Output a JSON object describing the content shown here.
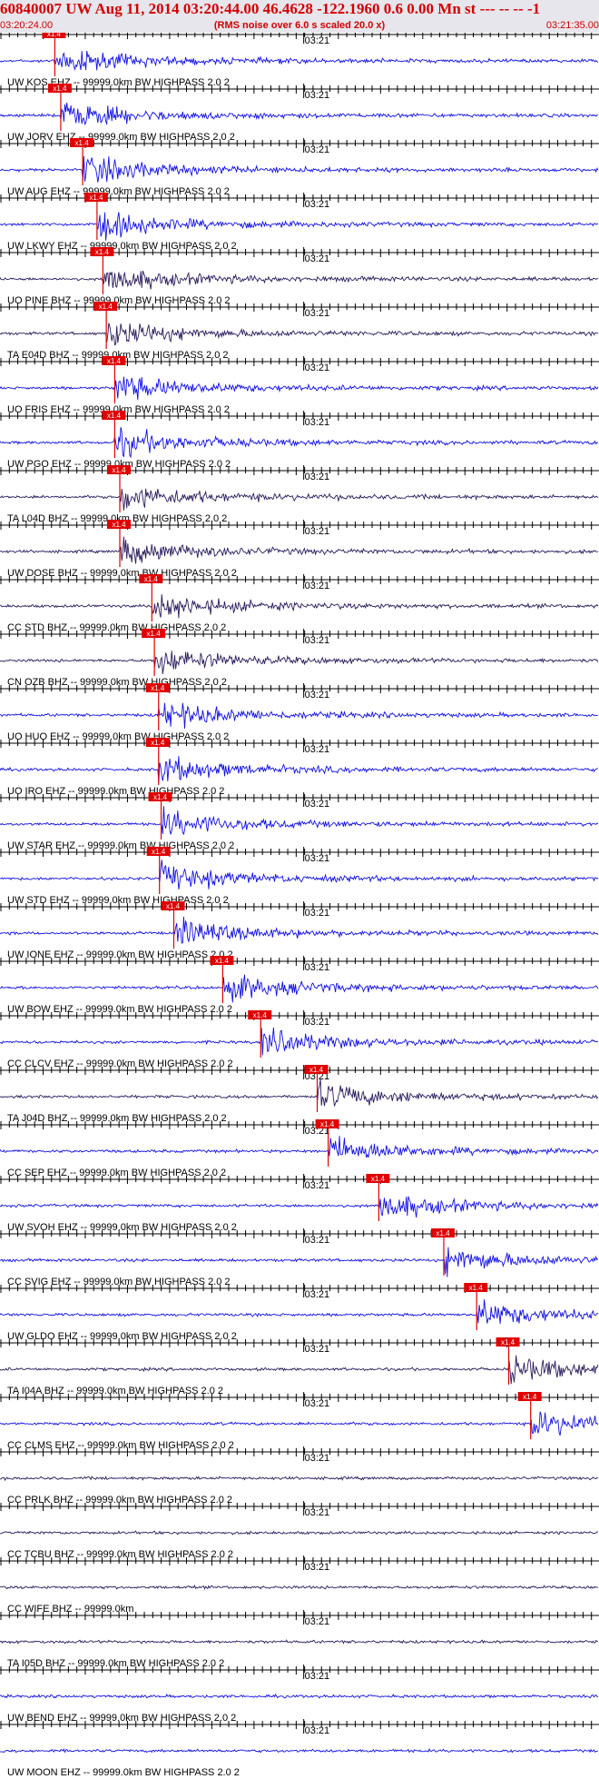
{
  "header": {
    "title": "60840007 UW Aug 11, 2014 03:20:44.00   46.4628 -122.1960  0.6 0.00 Mn st --- -- --   -1",
    "subtitle": "(RMS noise over 6.0 s scaled 20.0 x)",
    "start_time": "03:20:24.00",
    "end_time": "03:21:35.00"
  },
  "colors": {
    "wave_blue": "#1010e8",
    "wave_dark": "#2a1a5e",
    "pick": "#e00000",
    "marker_bg": "#e00000"
  },
  "chart_data": {
    "type": "seismogram",
    "time_tick_label": "03:21",
    "pick_label": "x1.4",
    "x_range_seconds": [
      0,
      71
    ],
    "traces": [
      {
        "label": "UW KOS EHZ -- 99999.0km BW  HIGHPASS  2.0  2",
        "color": "blue",
        "pick_s": 6.5
      },
      {
        "label": "UW JORV EHZ -- 99999.0km BW  HIGHPASS  2.0  2",
        "color": "blue",
        "pick_s": 7.2
      },
      {
        "label": "UW AUG EHZ -- 99999.0km BW  HIGHPASS  2.0  2",
        "color": "blue",
        "pick_s": 9.8
      },
      {
        "label": "UW LKWY EHZ -- 99999.0km BW  HIGHPASS  2.0  2",
        "color": "blue",
        "pick_s": 11.5
      },
      {
        "label": "UO PINE BHZ -- 99999.0km BW  HIGHPASS  2.0  2",
        "color": "dark",
        "pick_s": 12.2
      },
      {
        "label": "TA E04D BHZ -- 99999.0km BW  HIGHPASS  2.0  2",
        "color": "dark",
        "pick_s": 12.6
      },
      {
        "label": "UO FRIS EHZ -- 99999.0km BW  HIGHPASS  2.0  2",
        "color": "blue",
        "pick_s": 13.6
      },
      {
        "label": "UW PGO EHZ -- 99999.0km BW  HIGHPASS  2.0  2",
        "color": "blue",
        "pick_s": 13.6
      },
      {
        "label": "TA L04D BHZ -- 99999.0km BW  HIGHPASS  2.0  2",
        "color": "dark",
        "pick_s": 14.2
      },
      {
        "label": "UW DOSE BHZ -- 99999.0km BW  HIGHPASS  2.0  2",
        "color": "dark",
        "pick_s": 14.2
      },
      {
        "label": "CC STD BHZ -- 99999.0km BW  HIGHPASS  2.0  2",
        "color": "dark",
        "pick_s": 18.0
      },
      {
        "label": "CN OZB BHZ -- 99999.0km BW  HIGHPASS  2.0  2",
        "color": "dark",
        "pick_s": 18.3
      },
      {
        "label": "UO HUO EHZ -- 99999.0km BW  HIGHPASS  2.0  2",
        "color": "blue",
        "pick_s": 18.8
      },
      {
        "label": "UO IRO EHZ -- 99999.0km BW  HIGHPASS  2.0  2",
        "color": "blue",
        "pick_s": 18.8
      },
      {
        "label": "UW STAR EHZ -- 99999.0km BW  HIGHPASS  2.0  2",
        "color": "blue",
        "pick_s": 19.1
      },
      {
        "label": "UW STD EHZ -- 99999.0km BW  HIGHPASS  2.0  2",
        "color": "blue",
        "pick_s": 18.9
      },
      {
        "label": "UW IONE EHZ -- 99999.0km BW  HIGHPASS  2.0  2",
        "color": "blue",
        "pick_s": 20.6
      },
      {
        "label": "UW BOW EHZ -- 99999.0km BW  HIGHPASS  2.0  2",
        "color": "blue",
        "pick_s": 26.4
      },
      {
        "label": "CC CLCV EHZ -- 99999.0km BW  HIGHPASS  2.0  2",
        "color": "blue",
        "pick_s": 30.9
      },
      {
        "label": "TA J04D BHZ -- 99999.0km BW  HIGHPASS  2.0  2",
        "color": "dark",
        "pick_s": 37.6
      },
      {
        "label": "CC SEP EHZ -- 99999.0km BW  HIGHPASS  2.0  2",
        "color": "blue",
        "pick_s": 38.9
      },
      {
        "label": "UW SVOH EHZ -- 99999.0km BW  HIGHPASS  2.0  2",
        "color": "blue",
        "pick_s": 44.9
      },
      {
        "label": "CC SVIG EHZ -- 99999.0km BW  HIGHPASS  2.0  2",
        "color": "blue",
        "pick_s": 52.6
      },
      {
        "label": "UW GLDO EHZ -- 99999.0km BW  HIGHPASS  2.0  2",
        "color": "blue",
        "pick_s": 56.5
      },
      {
        "label": "TA I04A BHZ -- 99999.0km BW  HIGHPASS  2.0  2",
        "color": "dark",
        "pick_s": 60.3
      },
      {
        "label": "CC CLMS EHZ -- 99999.0km BW  HIGHPASS  2.0  2",
        "color": "blue",
        "pick_s": 62.9
      },
      {
        "label": "CC PRLK BHZ -- 99999.0km BW  HIGHPASS  2.0  2",
        "color": "dark",
        "pick_s": null
      },
      {
        "label": "CC TCBU BHZ -- 99999.0km BW  HIGHPASS  2.0  2",
        "color": "dark",
        "pick_s": null
      },
      {
        "label": "CC WIFE BHZ -- 99999.0km",
        "color": "dark",
        "pick_s": null
      },
      {
        "label": "TA I05D BHZ -- 99999.0km BW  HIGHPASS  2.0  2",
        "color": "dark",
        "pick_s": null
      },
      {
        "label": "UW BEND EHZ -- 99999.0km BW  HIGHPASS  2.0  2",
        "color": "blue",
        "pick_s": null
      },
      {
        "label": "UW MOON EHZ -- 99999.0km BW  HIGHPASS  2.0  2",
        "color": "blue",
        "pick_s": null
      }
    ]
  }
}
